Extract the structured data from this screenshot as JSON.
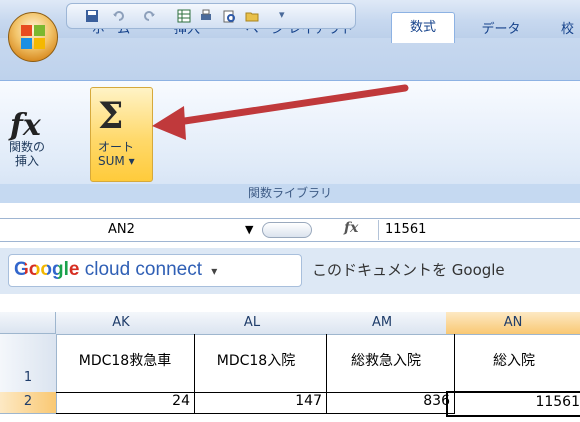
{
  "tabs": [
    {
      "label": "ホーム",
      "active": false
    },
    {
      "label": "挿入",
      "active": false
    },
    {
      "label": "ページ レイアウト",
      "active": false
    },
    {
      "label": "数式",
      "active": true
    },
    {
      "label": "データ",
      "active": false
    },
    {
      "label": "校",
      "active": false
    }
  ],
  "ribbon": {
    "insert_function_label": "関数の\n挿入",
    "autosum_label": "オート\nSUM ▾",
    "group_name": "関数ライブラリ",
    "icons": {
      "insert_function": "fx-icon",
      "autosum": "sigma-icon"
    }
  },
  "formula_bar": {
    "cell_name": "AN2",
    "fx": "fx",
    "value": "11561"
  },
  "google_bar": {
    "logo_google": "Google",
    "logo_rest": " cloud connect",
    "dropdown": "▾",
    "caption": "このドキュメントを Google"
  },
  "grid": {
    "columns": [
      "AK",
      "AL",
      "AM",
      "AN"
    ],
    "selected_column": "AN",
    "rows": [
      {
        "row": "1",
        "cells": [
          "MDC18救急車",
          "MDC18入院",
          "総救急入院",
          "総入院"
        ]
      },
      {
        "row": "2",
        "cells": [
          "24",
          "147",
          "836",
          "11561"
        ]
      }
    ]
  },
  "colors": {
    "accent": "#15428b",
    "arrow": "#c0393b",
    "autosum_highlight": "#ffd96b"
  }
}
